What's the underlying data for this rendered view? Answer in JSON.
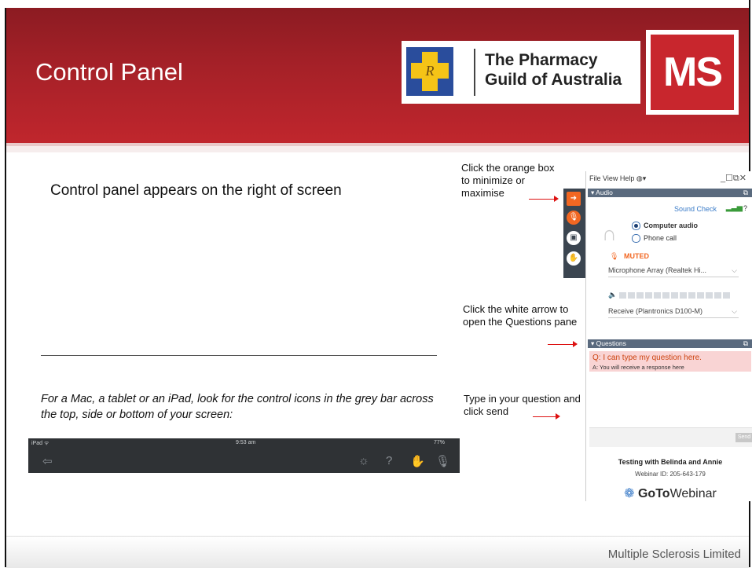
{
  "slide": {
    "title": "Control Panel",
    "main_text": "Control panel appears on the right of screen",
    "mac_text": "For a Mac, a tablet or an iPad, look for the control icons in the grey bar across the top, side or bottom of your screen:",
    "footer": "Multiple Sclerosis Limited"
  },
  "logos": {
    "guild_line1": "The Pharmacy",
    "guild_line2": "Guild of Australia",
    "guild_cross_letter": "R",
    "ms_text": "MS"
  },
  "ipad_bar": {
    "device": "iPad ᯤ",
    "time": "9:53 am",
    "battery": "77%",
    "icons": [
      "exit-icon",
      "gear-icon",
      "help-icon",
      "raise-hand-icon",
      "microphone-icon"
    ]
  },
  "annotations": {
    "orange_box": "Click the orange box to minimize or maximise",
    "white_arrow": "Click the white arrow to open the Questions pane",
    "type_question": "Type in your question and click send"
  },
  "gotowebinar": {
    "menu": "File  View  Help  ◍▾",
    "window_controls": "_☐⧉✕",
    "audio_label": "▾ Audio",
    "sound_check": "Sound Check",
    "computer_audio": "Computer audio",
    "phone_call": "Phone call",
    "muted": "MUTED",
    "microphone": "Microphone Array (Realtek Hi...",
    "speaker": "Receive (Plantronics D100-M)",
    "questions_label": "▾ Questions",
    "question": "Q: I can type my question here.",
    "answer": "A: You will receive a response here",
    "send": "Send",
    "testing": "Testing with Belinda and Annie",
    "webinar_id": "Webinar ID: 205-643-179",
    "brand_goto": "GoTo",
    "brand_webinar": "Webinar"
  },
  "colors": {
    "header_red": "#a62128",
    "ms_red": "#c8262d",
    "orange": "#f26722",
    "panel_bar": "#5a6a7e"
  }
}
